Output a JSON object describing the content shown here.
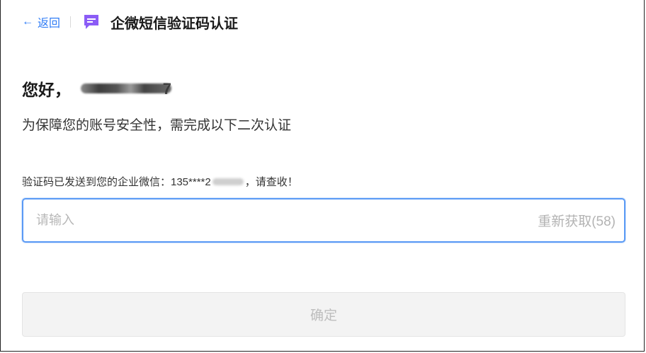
{
  "header": {
    "back_label": "返回",
    "back_icon": "arrow-left-icon",
    "title_icon": "message-icon",
    "title": "企微短信验证码认证",
    "accent_color": "#2f7cf6",
    "icon_color": "#8b5cf6"
  },
  "greeting": {
    "label": "您好，",
    "account_visible_tail": "7"
  },
  "subtitle": "为保障您的账号安全性，需完成以下二次认证",
  "notice": {
    "prefix": "验证码已发送到您的企业微信：135****2",
    "suffix": "，请查收！"
  },
  "code_field": {
    "placeholder": "请输入",
    "value": "",
    "resend_label": "重新获取(58)"
  },
  "confirm_label": "确定"
}
